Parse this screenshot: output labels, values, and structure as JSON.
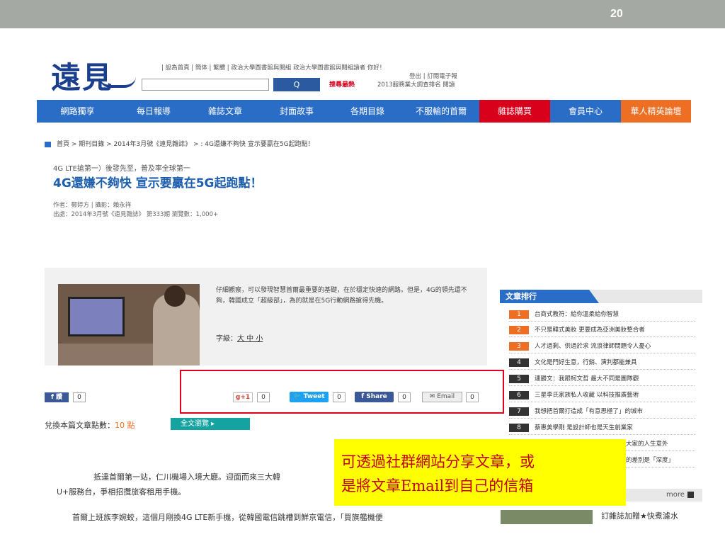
{
  "slide": {
    "number": "20"
  },
  "header": {
    "logo": "遠見",
    "top_links": "| 設為首頁 | 簡体 | 繁體 | 政治大學圖書館與閱組 政治大學圖書館與閱組讀者 你好！",
    "logout_line": "登出 | 訂閱電子報",
    "hot_label": "搜尋最熱",
    "survey_line": "2013服務業大調查排名 閱讀",
    "search_placeholder": "",
    "search_button": "Q"
  },
  "nav": {
    "items": [
      {
        "label": "網路獨享"
      },
      {
        "label": "每日報導"
      },
      {
        "label": "雜誌文章"
      },
      {
        "label": "封面故事"
      },
      {
        "label": "各期目錄"
      },
      {
        "label": "不服輸的首爾"
      },
      {
        "label": "雜誌購買"
      },
      {
        "label": "會員中心"
      },
      {
        "label": "華人精英論壇"
      }
    ]
  },
  "breadcrumb": "首頁 > 期刊目錄 > 2014年3月號《遠見雜誌》 > : 4G還嫌不夠快 宣示要贏在5G起跑點！",
  "article": {
    "kicker": "4G LTE搶第一）後發先至，普及率全球第一",
    "title": "4G還嫌不夠快 宣示要贏在5G起跑點！",
    "author": "作者：鄭婷方 | 攝影：賴永祥",
    "source": "出處：2014年3月號《遠見雜誌》 第333期  瀏覽數：1,000+",
    "summary": "仔細觀察，可以發現智慧首爾最重要的基礎，在於穩定快速的網路。但是，4G的領先還不夠，韓國成立「超級部」，為的就是在5G行動網路搶得先機。",
    "font_size_label": "字級：",
    "font_size_options": "大 中 小",
    "body_line1": "抵達首爾第一站，仁川機場入境大廳。迎面而來三大韓",
    "body_line2": "U+服務台，爭相招攬旅客租用手機。",
    "body_line3": "首爾上班族李婉蛟，這個月剛換4G LTE新手機，從韓國電信跳槽到鮮京電信，「買旗艦機便"
  },
  "share": {
    "fb_like": "f 讚",
    "fb_like_count": "0",
    "gplus": "g+1",
    "gplus_count": "0",
    "tweet": "Tweet",
    "tweet_count": "0",
    "fshare": "f Share",
    "fshare_count": "0",
    "email": "Email",
    "email_count": "0"
  },
  "points": {
    "label": "兌換本篇文章點數：",
    "value": "10 點",
    "fulltext": "全文瀏覽"
  },
  "ranking": {
    "title": "文章排行",
    "items": [
      {
        "num": "1",
        "text": "台商式教符：給你溫柔給你智慧"
      },
      {
        "num": "2",
        "text": "不只是韓式美妝 更要成為亞洲美妝整合者"
      },
      {
        "num": "3",
        "text": "人才過剩、供過於求 流浪律師問題令人憂心"
      },
      {
        "num": "4",
        "text": "文化是門好生意，行銷、演判都能兼具"
      },
      {
        "num": "5",
        "text": "連勝文：我跟柯文哲 最大不同是團隊觀"
      },
      {
        "num": "6",
        "text": "三星李氏家族私人收藏 以科技推廣藝術"
      },
      {
        "num": "7",
        "text": "我想把首爾打造成「有意思極了」的城市"
      },
      {
        "num": "8",
        "text": "蔡惠美學剛 是設計師也是天生創業家"
      },
      {
        "num": "",
        "text": "大家的人生意外"
      },
      {
        "num": "",
        "text": "的差別是「深度」"
      }
    ],
    "more": "more"
  },
  "sidebar": {
    "sub_item": "訂雜誌加贈★快煮濾水"
  },
  "callout": {
    "line1": "可透過社群網站分享文章，或",
    "line2": "是將文章Email到自己的信箱"
  }
}
